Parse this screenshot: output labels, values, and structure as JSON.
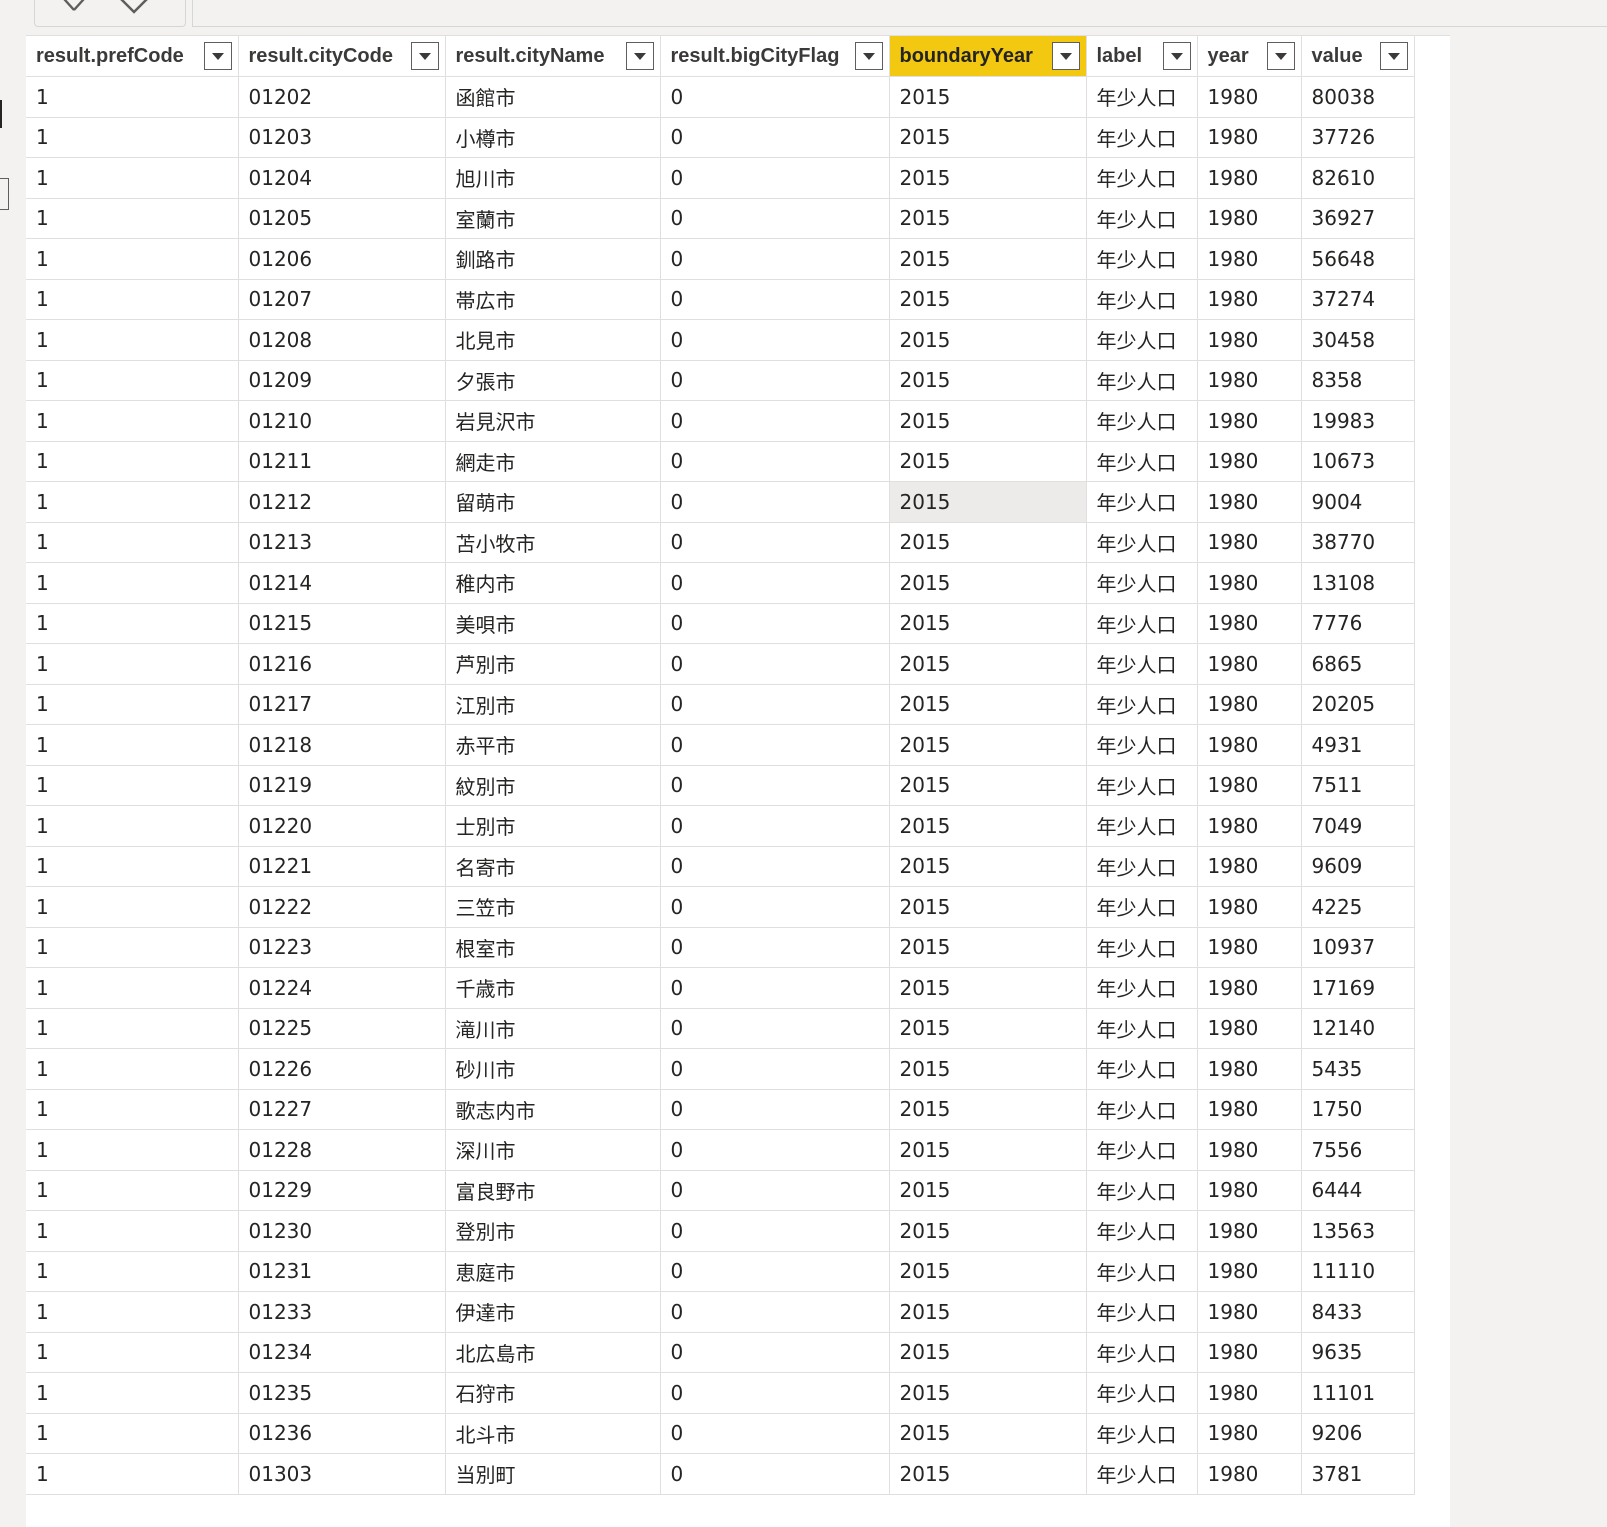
{
  "columns": [
    "result.prefCode",
    "result.cityCode",
    "result.cityName",
    "result.bigCityFlag",
    "boundaryYear",
    "label",
    "year",
    "value"
  ],
  "highlight_color": "#f2c811",
  "rows": [
    [
      "1",
      "01202",
      "函館市",
      "0",
      "2015",
      "年少人口",
      "1980",
      "80038"
    ],
    [
      "1",
      "01203",
      "小樽市",
      "0",
      "2015",
      "年少人口",
      "1980",
      "37726"
    ],
    [
      "1",
      "01204",
      "旭川市",
      "0",
      "2015",
      "年少人口",
      "1980",
      "82610"
    ],
    [
      "1",
      "01205",
      "室蘭市",
      "0",
      "2015",
      "年少人口",
      "1980",
      "36927"
    ],
    [
      "1",
      "01206",
      "釧路市",
      "0",
      "2015",
      "年少人口",
      "1980",
      "56648"
    ],
    [
      "1",
      "01207",
      "帯広市",
      "0",
      "2015",
      "年少人口",
      "1980",
      "37274"
    ],
    [
      "1",
      "01208",
      "北見市",
      "0",
      "2015",
      "年少人口",
      "1980",
      "30458"
    ],
    [
      "1",
      "01209",
      "夕張市",
      "0",
      "2015",
      "年少人口",
      "1980",
      "8358"
    ],
    [
      "1",
      "01210",
      "岩見沢市",
      "0",
      "2015",
      "年少人口",
      "1980",
      "19983"
    ],
    [
      "1",
      "01211",
      "網走市",
      "0",
      "2015",
      "年少人口",
      "1980",
      "10673"
    ],
    [
      "1",
      "01212",
      "留萌市",
      "0",
      "2015",
      "年少人口",
      "1980",
      "9004"
    ],
    [
      "1",
      "01213",
      "苫小牧市",
      "0",
      "2015",
      "年少人口",
      "1980",
      "38770"
    ],
    [
      "1",
      "01214",
      "稚内市",
      "0",
      "2015",
      "年少人口",
      "1980",
      "13108"
    ],
    [
      "1",
      "01215",
      "美唄市",
      "0",
      "2015",
      "年少人口",
      "1980",
      "7776"
    ],
    [
      "1",
      "01216",
      "芦別市",
      "0",
      "2015",
      "年少人口",
      "1980",
      "6865"
    ],
    [
      "1",
      "01217",
      "江別市",
      "0",
      "2015",
      "年少人口",
      "1980",
      "20205"
    ],
    [
      "1",
      "01218",
      "赤平市",
      "0",
      "2015",
      "年少人口",
      "1980",
      "4931"
    ],
    [
      "1",
      "01219",
      "紋別市",
      "0",
      "2015",
      "年少人口",
      "1980",
      "7511"
    ],
    [
      "1",
      "01220",
      "士別市",
      "0",
      "2015",
      "年少人口",
      "1980",
      "7049"
    ],
    [
      "1",
      "01221",
      "名寄市",
      "0",
      "2015",
      "年少人口",
      "1980",
      "9609"
    ],
    [
      "1",
      "01222",
      "三笠市",
      "0",
      "2015",
      "年少人口",
      "1980",
      "4225"
    ],
    [
      "1",
      "01223",
      "根室市",
      "0",
      "2015",
      "年少人口",
      "1980",
      "10937"
    ],
    [
      "1",
      "01224",
      "千歳市",
      "0",
      "2015",
      "年少人口",
      "1980",
      "17169"
    ],
    [
      "1",
      "01225",
      "滝川市",
      "0",
      "2015",
      "年少人口",
      "1980",
      "12140"
    ],
    [
      "1",
      "01226",
      "砂川市",
      "0",
      "2015",
      "年少人口",
      "1980",
      "5435"
    ],
    [
      "1",
      "01227",
      "歌志内市",
      "0",
      "2015",
      "年少人口",
      "1980",
      "1750"
    ],
    [
      "1",
      "01228",
      "深川市",
      "0",
      "2015",
      "年少人口",
      "1980",
      "7556"
    ],
    [
      "1",
      "01229",
      "富良野市",
      "0",
      "2015",
      "年少人口",
      "1980",
      "6444"
    ],
    [
      "1",
      "01230",
      "登別市",
      "0",
      "2015",
      "年少人口",
      "1980",
      "13563"
    ],
    [
      "1",
      "01231",
      "恵庭市",
      "0",
      "2015",
      "年少人口",
      "1980",
      "11110"
    ],
    [
      "1",
      "01233",
      "伊達市",
      "0",
      "2015",
      "年少人口",
      "1980",
      "8433"
    ],
    [
      "1",
      "01234",
      "北広島市",
      "0",
      "2015",
      "年少人口",
      "1980",
      "9635"
    ],
    [
      "1",
      "01235",
      "石狩市",
      "0",
      "2015",
      "年少人口",
      "1980",
      "11101"
    ],
    [
      "1",
      "01236",
      "北斗市",
      "0",
      "2015",
      "年少人口",
      "1980",
      "9206"
    ],
    [
      "1",
      "01303",
      "当別町",
      "0",
      "2015",
      "年少人口",
      "1980",
      "3781"
    ]
  ]
}
